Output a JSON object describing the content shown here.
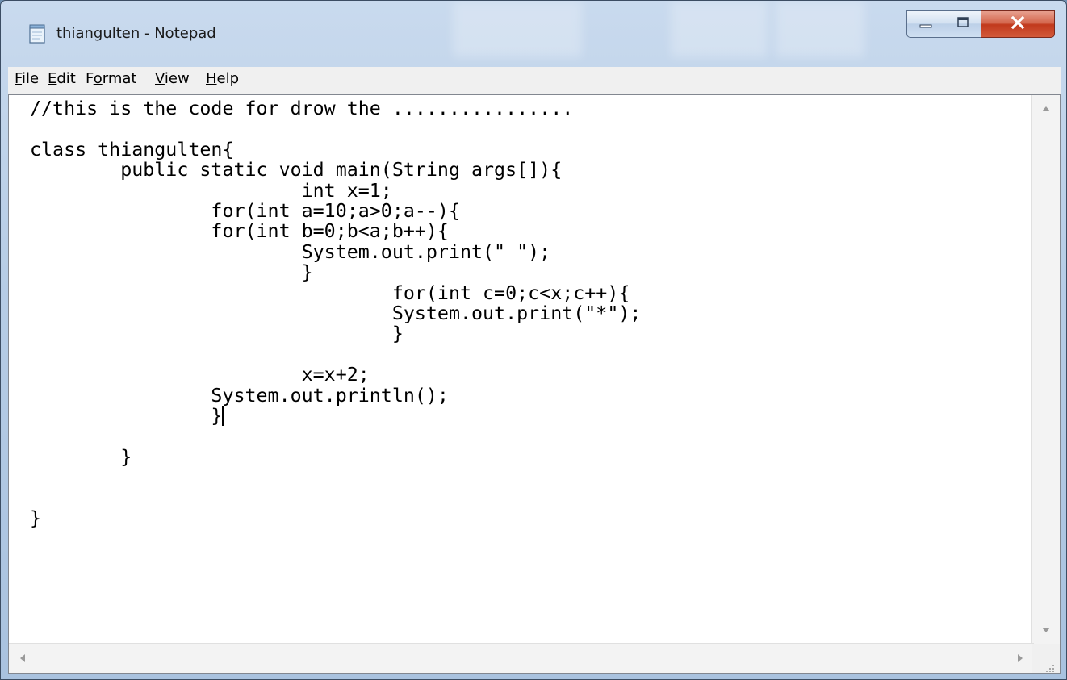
{
  "window": {
    "title": "thiangulten - Notepad"
  },
  "menu": [
    "File",
    "Edit",
    "Format",
    "View",
    "Help"
  ],
  "menu_accelerators": [
    "F",
    "E",
    "o",
    "V",
    "H"
  ],
  "editor": {
    "lines": [
      "//this is the code for drow the ................",
      "",
      "class thiangulten{",
      "        public static void main(String args[]){",
      "                        int x=1;",
      "                for(int a=10;a>0;a--){",
      "                for(int b=0;b<a;b++){",
      "                        System.out.print(\" \");",
      "                        }",
      "                                for(int c=0;c<x;c++){",
      "                                System.out.print(\"*\");",
      "                                }",
      "",
      "                        x=x+2;",
      "                System.out.println();",
      "                }",
      "",
      "        }",
      "",
      "",
      "}"
    ],
    "caret_line": 15
  },
  "colors": {
    "frame": "#b7cde6",
    "close_button": "#c1391c",
    "menubar": "#f0f0f0",
    "editor_bg": "#ffffff"
  },
  "icons": [
    "notepad-icon",
    "minimize-icon",
    "maximize-icon",
    "close-icon"
  ]
}
